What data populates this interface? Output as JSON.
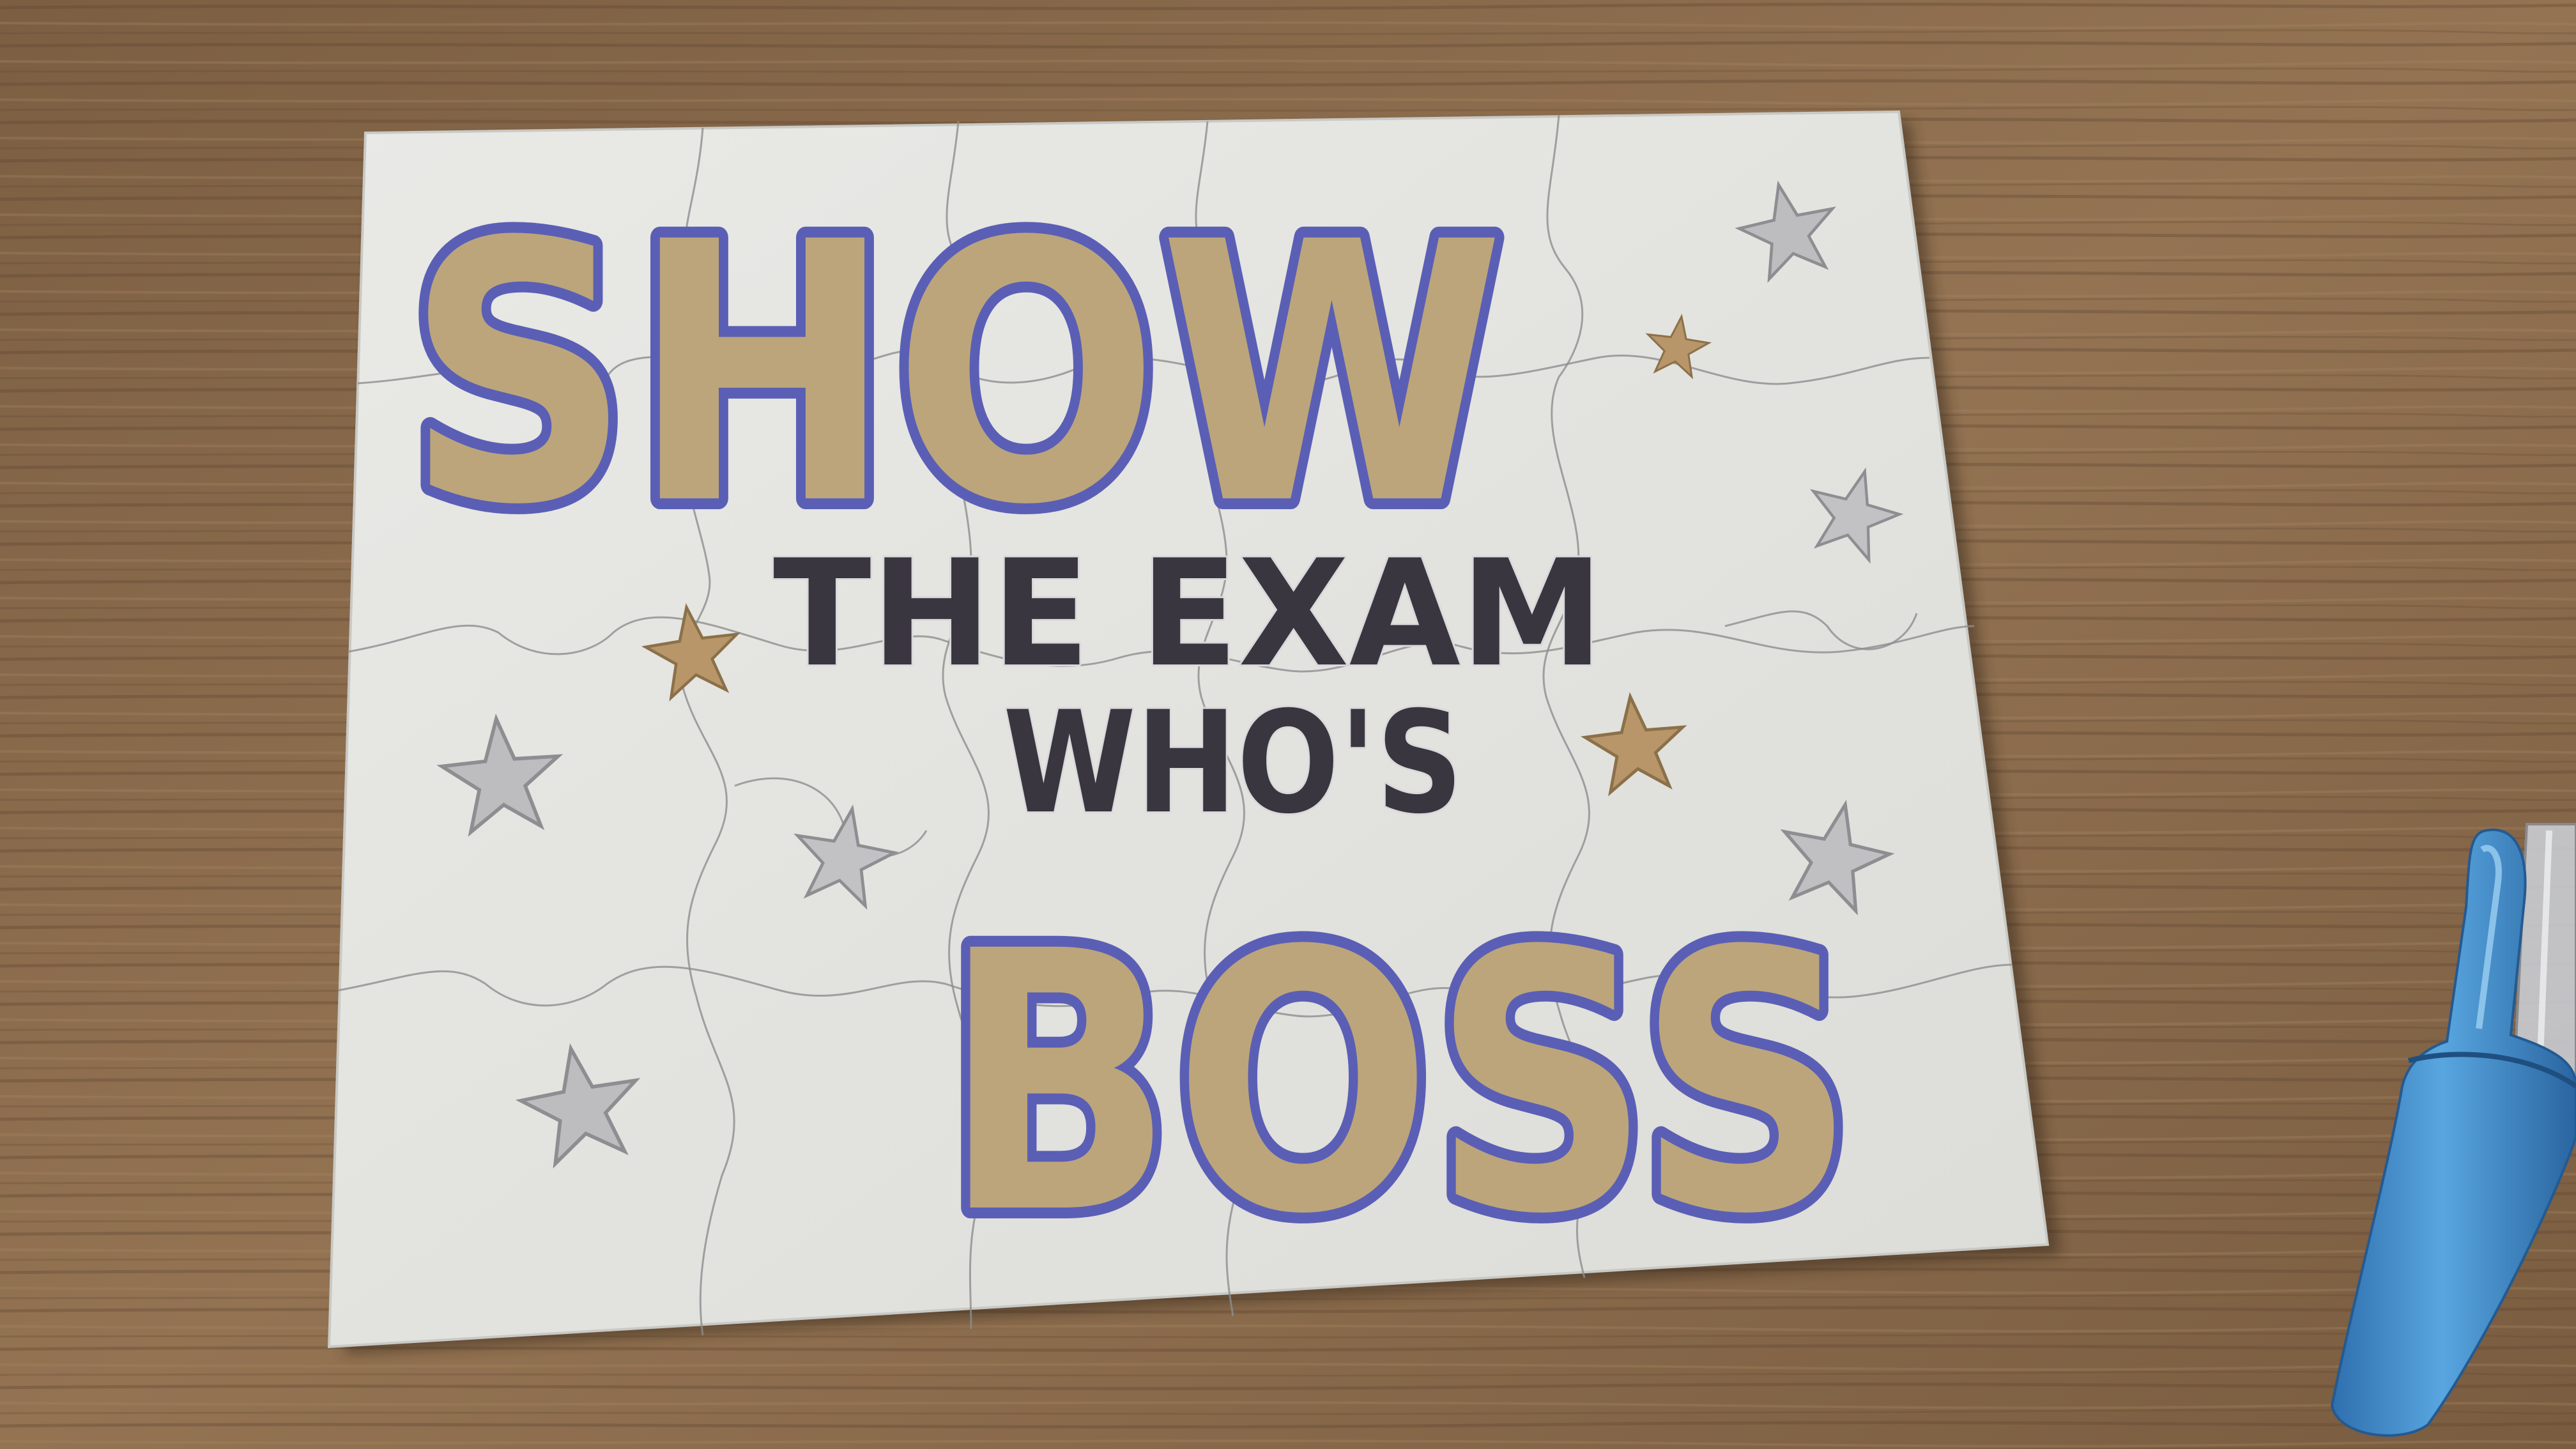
{
  "puzzle": {
    "line1": "SHOW",
    "line2": "THE EXAM",
    "line3": "WHO'S",
    "line4": "BOSS"
  },
  "colors": {
    "wood": "#8a6a4a",
    "wood_dark": "#6e5238",
    "card": "#e6e6e3",
    "gold_fill": "#bca57a",
    "blue_outline": "#5a5fb5",
    "black_marker": "#3a3640",
    "silver_star": "#b9b9bb",
    "gold_star": "#b89766",
    "pen_blue": "#3b87c8"
  },
  "stars": [
    {
      "name": "silver-star",
      "color": "silver"
    },
    {
      "name": "gold-star",
      "color": "gold"
    },
    {
      "name": "silver-star",
      "color": "silver"
    },
    {
      "name": "gold-star",
      "color": "gold"
    },
    {
      "name": "silver-star",
      "color": "silver"
    },
    {
      "name": "silver-star",
      "color": "silver"
    },
    {
      "name": "gold-star",
      "color": "gold"
    },
    {
      "name": "silver-star",
      "color": "silver"
    },
    {
      "name": "silver-star",
      "color": "silver"
    }
  ]
}
